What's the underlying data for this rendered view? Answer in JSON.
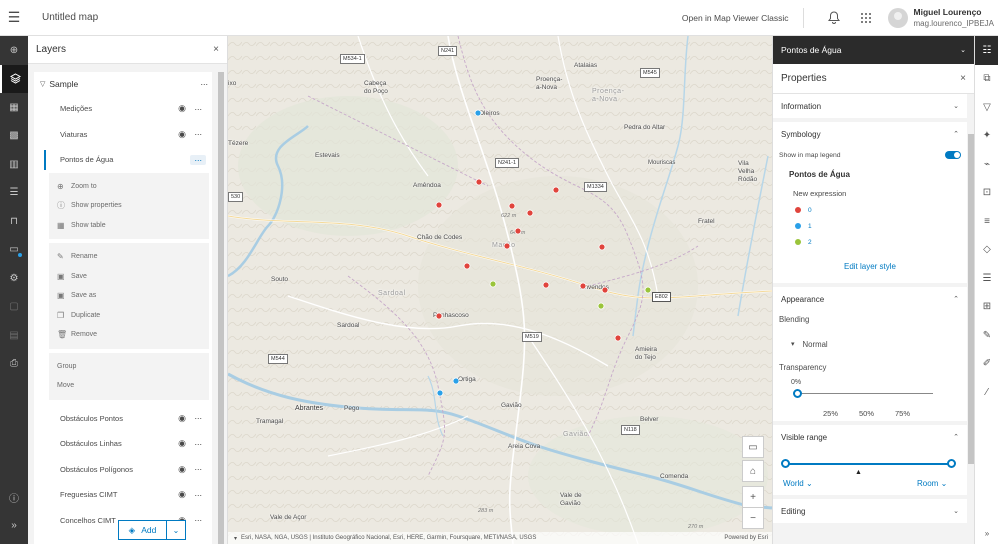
{
  "header": {
    "title": "Untitled map",
    "open_classic": "Open in Map Viewer Classic",
    "user_name": "Miguel Lourenço",
    "user_handle": "mag.lourenco_IPBEJA"
  },
  "left_toolbar": {
    "items": [
      "add-icon",
      "layers-icon",
      "table-icon",
      "basemap-icon",
      "charts-icon",
      "legend-icon",
      "bookmarks-icon",
      "media-icon",
      "settings-icon",
      "print-icon",
      "sketch-icon",
      "measure-icon"
    ]
  },
  "layers_panel": {
    "title": "Layers",
    "group": "Sample",
    "layers_top": [
      "Medições",
      "Viaturas",
      "Pontos de Água"
    ],
    "menu_group1": [
      "Zoom to",
      "Show properties",
      "Show table"
    ],
    "menu_group2": [
      "Rename",
      "Save",
      "Save as",
      "Duplicate",
      "Remove"
    ],
    "menu_group3": [
      "Group",
      "Move"
    ],
    "layers_bottom": [
      "Obstáculos Pontos",
      "Obstáculos Linhas",
      "Obstáculos Polígonos",
      "Freguesias CIMT",
      "Concelhos CIMT"
    ],
    "add_label": "Add"
  },
  "map": {
    "places": [
      {
        "text": "Cabeça",
        "sub": "do Poço"
      },
      {
        "text": "Proença-",
        "sub": "a-Nova"
      }
    ],
    "labels": {
      "atalaias": "Atalaias",
      "proenca_a_nova": "Proença-\na-Nova",
      "proenca_a_nova_2": "Proença-\na-Nova",
      "cabeca_do_poco": "Cabeça\ndo Poço",
      "oleiros": "Oleiros",
      "estevais": "Estevais",
      "pedra_do_altar": "Pedra do Altar",
      "amendoa": "Amêndoa",
      "mouriscas": "Mouriscas",
      "chao_de_codes": "Chão de Codes",
      "macao": "Mação",
      "souto": "Souto",
      "envendos": "Envendos",
      "fratel": "Fratel",
      "vila_velha": "Vila\nVelha\nRódão",
      "penhascoso": "Penhascoso",
      "sardoal": "Sardoal",
      "sardoal_region": "Sardoal",
      "amieira": "Amieira\ndo Tejo",
      "ortiga": "Ortiga",
      "abrantes": "Abrantes",
      "pego": "Pego",
      "gaviao": "Gavião",
      "gaviao_region": "Gavião",
      "tramagal": "Tramagal",
      "belver": "Belver",
      "areia_cova": "Areia Cova",
      "comenda": "Comenda",
      "vale_de_gaviao": "Vale de\nGavião",
      "vale_de_acor": "Vale de Açor",
      "tezere": "Tézere",
      "xo": "ixo"
    },
    "shields": [
      "N241",
      "M534-1",
      "M545",
      "N241-1",
      "M1334",
      "530",
      "E802",
      "M519",
      "M544",
      "N118"
    ],
    "elevations": [
      "622 m",
      "647 m",
      "270 m",
      "283 m"
    ],
    "points_red_count": 14,
    "points_blue_count": 3,
    "points_green_count": 3,
    "attribution": "Esri, NASA, NGA, USGS | Instituto Geográfico Nacional, Esri, HERE, Garmin, Foursquare, METI/NASA, USGS",
    "powered_by": "Powered by Esri"
  },
  "properties_panel": {
    "layer_name": "Pontos de Água",
    "title": "Properties",
    "information": "Information",
    "symbology": "Symbology",
    "show_in_legend": "Show in map legend",
    "legend_layer": "Pontos de Água",
    "legend_expression": "New expression",
    "legend_items": [
      {
        "label": "0",
        "color": "#e0443c"
      },
      {
        "label": "1",
        "color": "#2aa0e8"
      },
      {
        "label": "2",
        "color": "#9ac43a"
      }
    ],
    "edit_style": "Edit layer style",
    "appearance": "Appearance",
    "blending": "Blending",
    "blending_value": "Normal",
    "transparency": "Transparency",
    "transparency_value": "0%",
    "transparency_ticks": [
      "25%",
      "50%",
      "75%"
    ],
    "visible_range": "Visible range",
    "range_min": "World",
    "range_max": "Room",
    "editing": "Editing"
  },
  "right_toolbar": {
    "items": [
      "properties-icon",
      "styles-icon",
      "filter-icon",
      "effects-icon",
      "pop-ups-icon",
      "labels-icon",
      "fields-icon",
      "forms-icon",
      "configure-icon",
      "aggregation-icon",
      "edit-icon",
      "sketch-icon",
      "pencil-icon"
    ]
  }
}
